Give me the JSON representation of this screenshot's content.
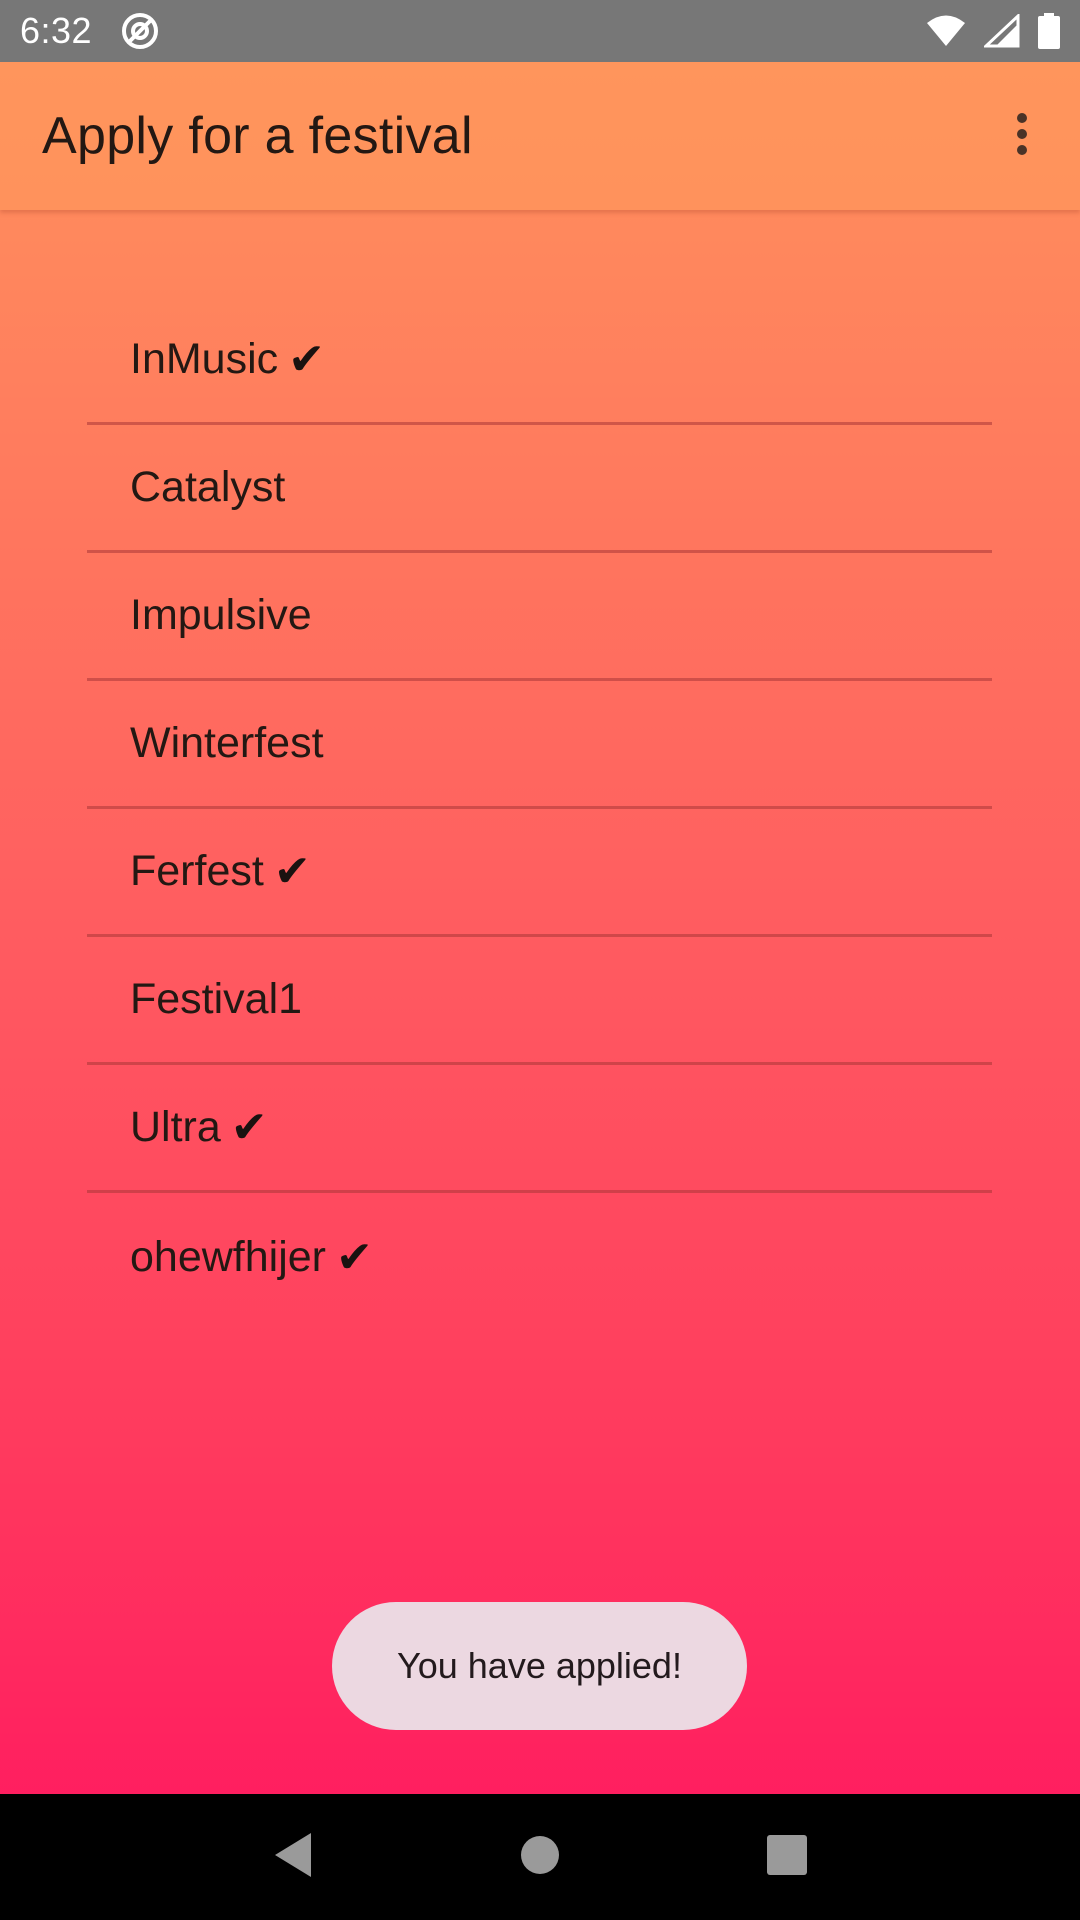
{
  "status_bar": {
    "time": "6:32",
    "icons": [
      "at-sign-icon",
      "wifi-icon",
      "signal-icon",
      "battery-icon"
    ]
  },
  "app_bar": {
    "title": "Apply for a festival",
    "overflow_icon": "more-vert-icon"
  },
  "festivals": [
    {
      "name": "InMusic",
      "applied": true,
      "check": "✔"
    },
    {
      "name": "Catalyst",
      "applied": false,
      "check": ""
    },
    {
      "name": "Impulsive",
      "applied": false,
      "check": ""
    },
    {
      "name": "Winterfest",
      "applied": false,
      "check": ""
    },
    {
      "name": "Ferfest",
      "applied": true,
      "check": "✔"
    },
    {
      "name": "Festival1",
      "applied": false,
      "check": ""
    },
    {
      "name": "Ultra",
      "applied": true,
      "check": "✔"
    },
    {
      "name": "ohewfhijer",
      "applied": true,
      "check": "✔"
    }
  ],
  "toast": {
    "message": "You have applied!"
  },
  "nav_bar": {
    "icons": [
      "back-icon",
      "home-icon",
      "recents-icon"
    ]
  },
  "colors": {
    "gradient_top": "#ff955c",
    "gradient_bottom": "#ff1560",
    "status_bar": "#777777",
    "toast_bg": "#ecd8e1"
  }
}
